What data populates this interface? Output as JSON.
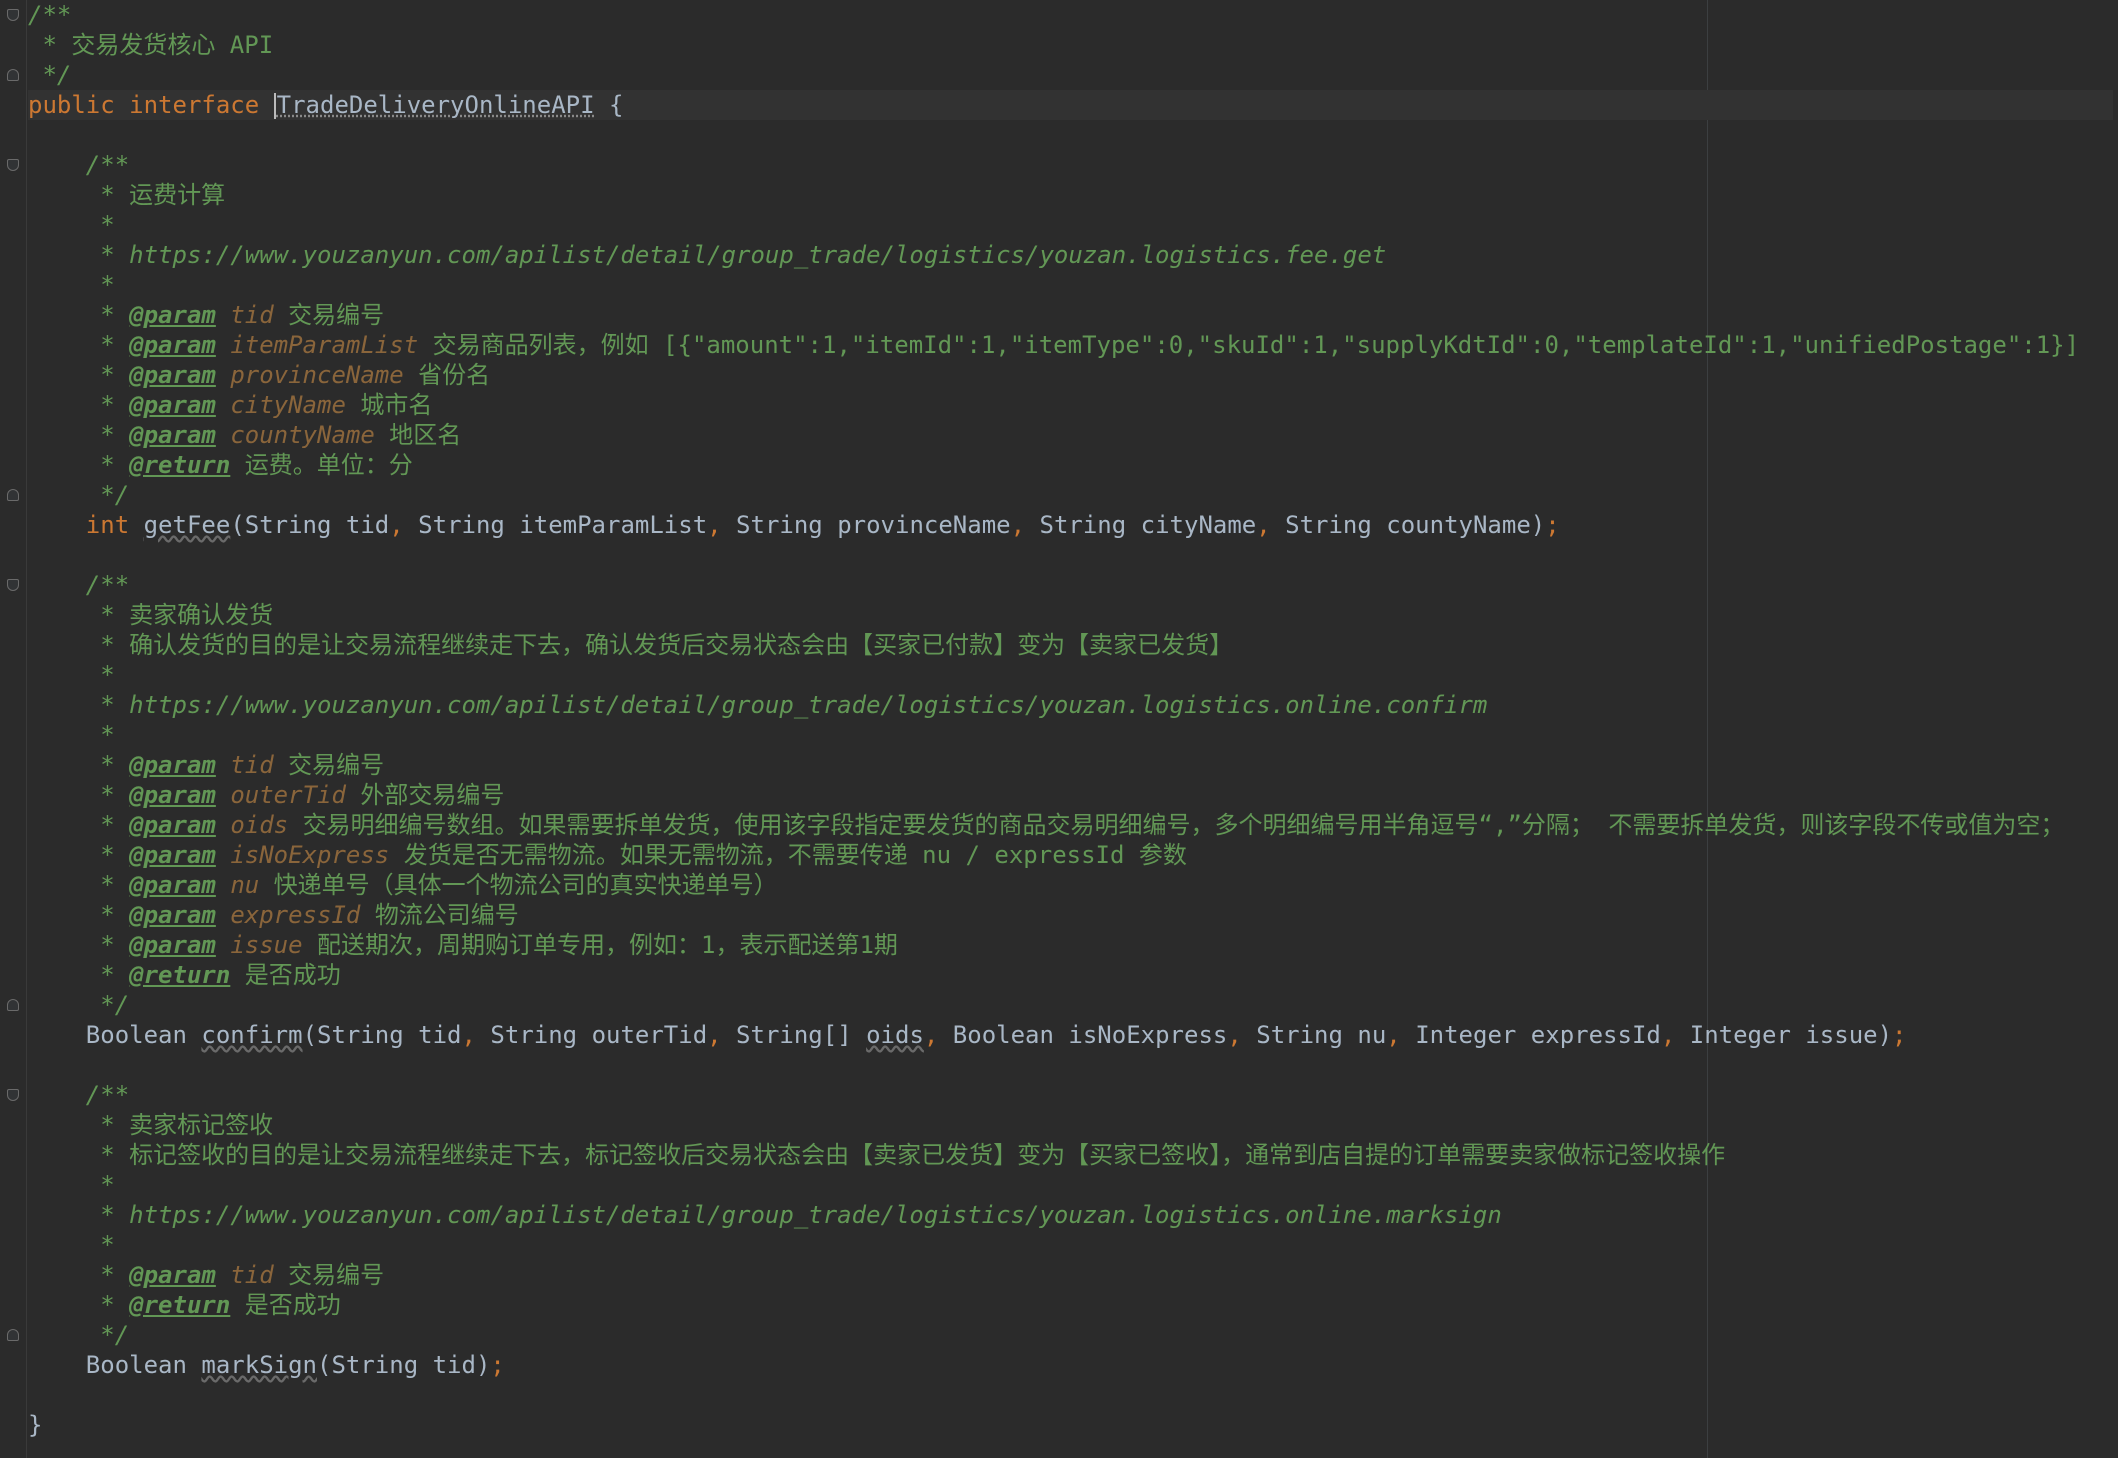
{
  "editor": {
    "class_doc": "交易发货核心 API",
    "interface_keywords": [
      "public",
      "interface"
    ],
    "interface_name": "TradeDeliveryOnlineAPI",
    "open_brace": "{",
    "close_brace": "}"
  },
  "methods": [
    {
      "summary": "运费计算",
      "details": [],
      "url": "https://www.youzanyun.com/apilist/detail/group_trade/logistics/youzan.logistics.fee.get",
      "params": [
        {
          "name": "tid",
          "desc": "交易编号"
        },
        {
          "name": "itemParamList",
          "desc": "交易商品列表，例如 [{\"amount\":1,\"itemId\":1,\"itemType\":0,\"skuId\":1,\"supplyKdtId\":0,\"templateId\":1,\"unifiedPostage\":1}]"
        },
        {
          "name": "provinceName",
          "desc": "省份名"
        },
        {
          "name": "cityName",
          "desc": "城市名"
        },
        {
          "name": "countyName",
          "desc": "地区名"
        }
      ],
      "return_desc": "运费。单位：分",
      "return_type": "int",
      "name": "getFee",
      "signature_args": "(String tid, String itemParamList, String provinceName, String cityName, String countyName)",
      "terminator": ";"
    },
    {
      "summary": "卖家确认发货",
      "details": [
        "确认发货的目的是让交易流程继续走下去，确认发货后交易状态会由【买家已付款】变为【卖家已发货】"
      ],
      "url": "https://www.youzanyun.com/apilist/detail/group_trade/logistics/youzan.logistics.online.confirm",
      "params": [
        {
          "name": "tid",
          "desc": "交易编号"
        },
        {
          "name": "outerTid",
          "desc": "外部交易编号"
        },
        {
          "name": "oids",
          "desc": "交易明细编号数组。如果需要拆单发货，使用该字段指定要发货的商品交易明细编号，多个明细编号用半角逗号“,”分隔； 不需要拆单发货，则该字段不传或值为空；"
        },
        {
          "name": "isNoExpress",
          "desc": "发货是否无需物流。如果无需物流，不需要传递 nu / expressId 参数"
        },
        {
          "name": "nu",
          "desc": "快递单号（具体一个物流公司的真实快递单号）"
        },
        {
          "name": "expressId",
          "desc": "物流公司编号"
        },
        {
          "name": "issue",
          "desc": "配送期次，周期购订单专用，例如：1，表示配送第1期"
        }
      ],
      "return_desc": "是否成功",
      "return_type": "Boolean",
      "name": "confirm",
      "signature_args": "(String tid, String outerTid, String[] oids, Boolean isNoExpress, String nu, Integer expressId, Integer issue)",
      "terminator": ";"
    },
    {
      "summary": "卖家标记签收",
      "details": [
        "标记签收的目的是让交易流程继续走下去，标记签收后交易状态会由【卖家已发货】变为【买家已签收】，通常到店自提的订单需要卖家做标记签收操作"
      ],
      "url": "https://www.youzanyun.com/apilist/detail/group_trade/logistics/youzan.logistics.online.marksign",
      "params": [
        {
          "name": "tid",
          "desc": "交易编号"
        }
      ],
      "return_desc": "是否成功",
      "return_type": "Boolean",
      "name": "markSign",
      "signature_args": "(String tid)",
      "terminator": ";"
    }
  ],
  "colors": {
    "background": "#2b2b2b",
    "comment": "#629755",
    "keyword": "#cc7832",
    "param_name": "#8a653b",
    "text": "#a9b7c6"
  }
}
